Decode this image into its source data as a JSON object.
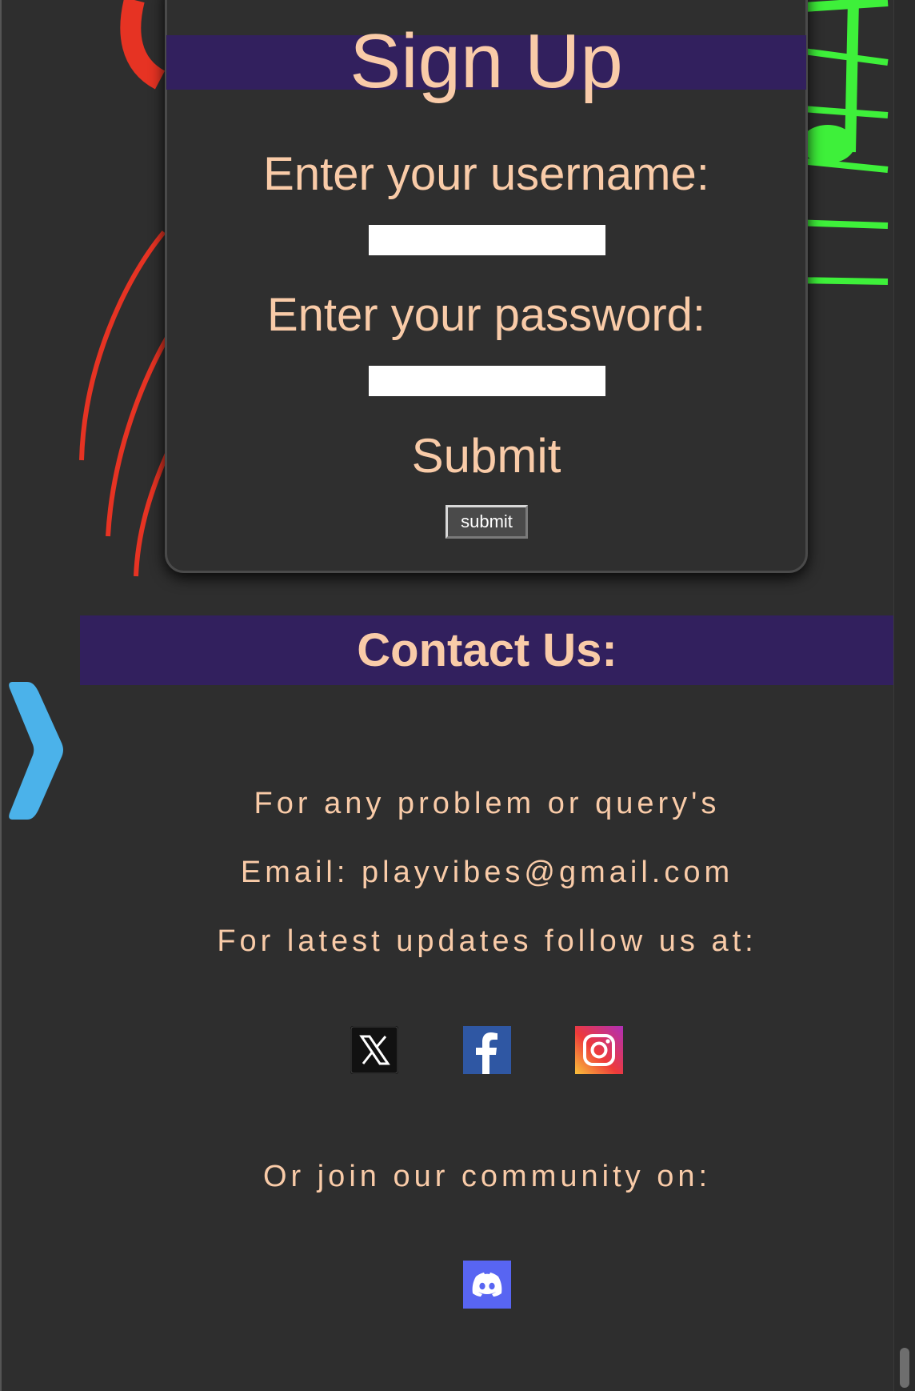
{
  "signup": {
    "title": "Sign Up",
    "username_label": "Enter your username:",
    "username_value": "",
    "password_label": "Enter your password:",
    "password_value": "",
    "submit_heading": "Submit",
    "submit_button_label": "submit"
  },
  "contact": {
    "title": "Contact Us:",
    "problem_text": "For any problem or query's",
    "email_text": "Email: playvibes@gmail.com",
    "follow_text": "For latest updates follow us at:",
    "social_icons": [
      "x-icon",
      "facebook-icon",
      "instagram-icon"
    ],
    "community_text": "Or join our community on:",
    "community_icon": "discord-icon"
  },
  "colors": {
    "background": "#2e2e2e",
    "band": "#32205e",
    "text": "#f9cba8",
    "arrow": "#4bb2ea",
    "facebook": "#2f57a3",
    "discord": "#5865f2",
    "deco_red": "#e63323",
    "deco_green": "#3ef03a"
  }
}
